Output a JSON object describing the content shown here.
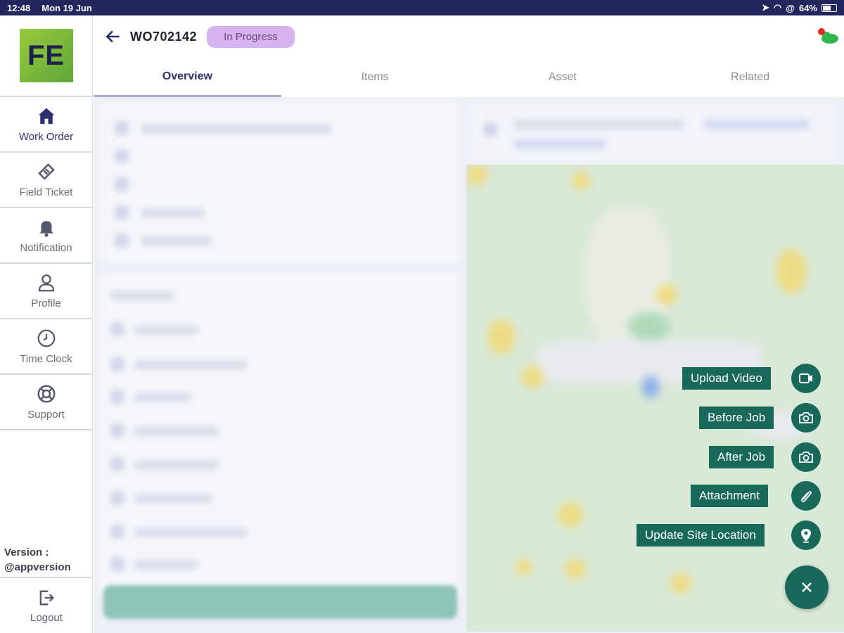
{
  "status_bar": {
    "time": "12:48",
    "date": "Mon 19 Jun",
    "battery": "64%",
    "battery_level": 0.64
  },
  "sidebar": {
    "logo_text": "FE",
    "items": [
      {
        "label": "Work Order",
        "icon": "home-icon",
        "active": true
      },
      {
        "label": "Field Ticket",
        "icon": "ticket-icon",
        "active": false
      },
      {
        "label": "Notification",
        "icon": "bell-icon",
        "active": false
      },
      {
        "label": "Profile",
        "icon": "user-icon",
        "active": false
      },
      {
        "label": "Time Clock",
        "icon": "clock-icon",
        "active": false
      },
      {
        "label": "Support",
        "icon": "lifebuoy-icon",
        "active": false
      }
    ],
    "version_label": "Version :",
    "version_value": "@appversion",
    "logout_label": "Logout"
  },
  "header": {
    "work_order_id": "WO702142",
    "status": "In Progress"
  },
  "tabs": [
    {
      "label": "Overview",
      "active": true
    },
    {
      "label": "Items",
      "active": false
    },
    {
      "label": "Asset",
      "active": false
    },
    {
      "label": "Related",
      "active": false
    }
  ],
  "fab_menu": {
    "actions": [
      {
        "label": "Upload Video",
        "icon": "video-icon"
      },
      {
        "label": "Before Job",
        "icon": "camera-icon"
      },
      {
        "label": "After Job",
        "icon": "camera-icon"
      },
      {
        "label": "Attachment",
        "icon": "paperclip-icon"
      },
      {
        "label": "Update Site Location",
        "icon": "location-pin-icon"
      }
    ],
    "close_icon": "close-icon"
  },
  "colors": {
    "accent": "#19695a",
    "status_chip": "#d6b3ee",
    "nav_active": "#2b2f6e",
    "status_bar": "#22265c"
  }
}
